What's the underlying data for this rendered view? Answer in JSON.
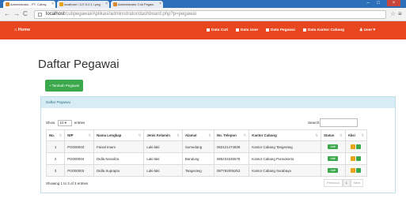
{
  "browser": {
    "tabs": [
      {
        "label": "Administrator - PT. Cahay"
      },
      {
        "label": "localhost / 127.0.0.1 / peg"
      },
      {
        "label": "Administrator Cuti Pegaw"
      }
    ],
    "url_host": "localhost",
    "url_path": "/cutipegawai/Aplikasi/administrator/dashboard.php?p=pegawai"
  },
  "navbar": {
    "home": "Home",
    "items": [
      "Data Cuti",
      "Data User",
      "Data Pegawai",
      "Data Kantor Cabang",
      "User"
    ]
  },
  "page": {
    "title": "Daftar Pegawai",
    "add_button": "+ Tambah Pegawai",
    "panel_title": "Daftar Pegawai",
    "show_label": "Show",
    "entries_value": "10",
    "entries_label": "entries",
    "search_label": "Search:",
    "info": "Showing 1 to 3 of 3 entries",
    "pager": {
      "prev": "Previous",
      "current": "1",
      "next": "Next"
    }
  },
  "table": {
    "headers": [
      "No.",
      "NIP",
      "Nama Lengkap",
      "Jenis Kelamin",
      "Alamat",
      "No. Telepon",
      "Kantor Cabang",
      "Status",
      "Aksi"
    ],
    "rows": [
      {
        "no": "1",
        "nip": "PG000003",
        "nama": "Faisal Imam",
        "jk": "Laki-laki",
        "alamat": "Sumedang",
        "telp": "082121474839",
        "cabang": "Kantor Cabang Tangerang",
        "status": "Aktif"
      },
      {
        "no": "2",
        "nip": "PG000004",
        "nama": "Didla Novaliza",
        "jk": "Laki-laki",
        "alamat": "Bandung",
        "telp": "085234345678",
        "cabang": "Kantor Cabang Purwokerto",
        "status": "Aktif"
      },
      {
        "no": "3",
        "nip": "PG000003",
        "nama": "Didla Suprapto",
        "jk": "Laki-laki",
        "alamat": "Tangerang",
        "telp": "087782005253",
        "cabang": "Kantor Cabang Surabaya",
        "status": "Aktif"
      }
    ]
  },
  "colors": {
    "navbar": "#e8461f",
    "button_green": "#3aa84b",
    "panel_header": "#d7ecf5"
  }
}
